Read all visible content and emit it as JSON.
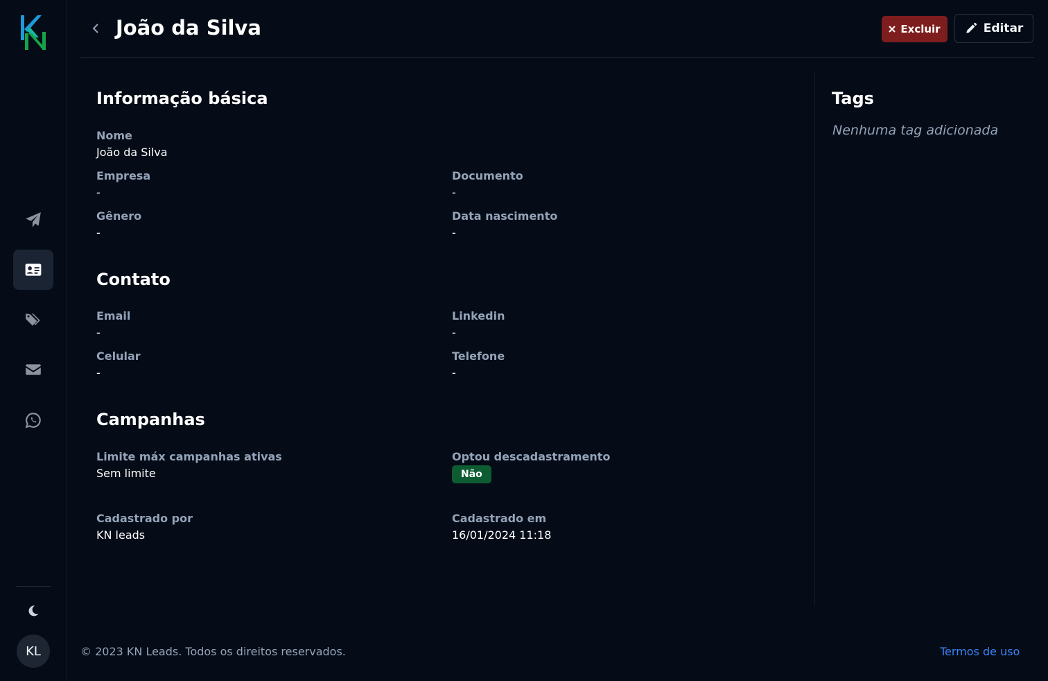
{
  "brand": {
    "logo_text": "KN"
  },
  "sidebar": {
    "items": [
      {
        "name": "campanhas",
        "icon": "paper-plane-icon",
        "active": false
      },
      {
        "name": "contatos",
        "icon": "address-card-icon",
        "active": true
      },
      {
        "name": "tags",
        "icon": "tags-icon",
        "active": false
      },
      {
        "name": "email",
        "icon": "envelope-icon",
        "active": false
      },
      {
        "name": "whatsapp",
        "icon": "whatsapp-icon",
        "active": false
      }
    ],
    "theme_icon": "moon-icon",
    "avatar_initials": "KL"
  },
  "header": {
    "title": "João da Silva",
    "delete_label": "Excluir",
    "edit_label": "Editar"
  },
  "basic": {
    "title": "Informação básica",
    "nome_label": "Nome",
    "nome_value": "João da Silva",
    "empresa_label": "Empresa",
    "empresa_value": "-",
    "documento_label": "Documento",
    "documento_value": "-",
    "genero_label": "Gênero",
    "genero_value": "-",
    "nascimento_label": "Data nascimento",
    "nascimento_value": "-"
  },
  "contact": {
    "title": "Contato",
    "email_label": "Email",
    "email_value": "-",
    "linkedin_label": "Linkedin",
    "linkedin_value": "-",
    "celular_label": "Celular",
    "celular_value": "-",
    "telefone_label": "Telefone",
    "telefone_value": "-"
  },
  "campaigns": {
    "title": "Campanhas",
    "limite_label": "Limite máx campanhas ativas",
    "limite_value": "Sem limite",
    "optout_label": "Optou descadastramento",
    "optout_value": "Não",
    "cadastrado_por_label": "Cadastrado por",
    "cadastrado_por_value": "KN leads",
    "cadastrado_em_label": "Cadastrado em",
    "cadastrado_em_value": "16/01/2024 11:18"
  },
  "tags": {
    "title": "Tags",
    "empty_text": "Nenhuma tag adicionada"
  },
  "footer": {
    "copyright": "© 2023 KN Leads. Todos os direitos reservados.",
    "terms_link": "Termos de uso"
  },
  "colors": {
    "background": "#050c17",
    "danger": "#7e1d1d",
    "success": "#0d5c32",
    "link": "#3b82f6",
    "muted": "#94a3b8",
    "logo_blue": "#1d9bd8",
    "logo_green": "#16a34a"
  }
}
